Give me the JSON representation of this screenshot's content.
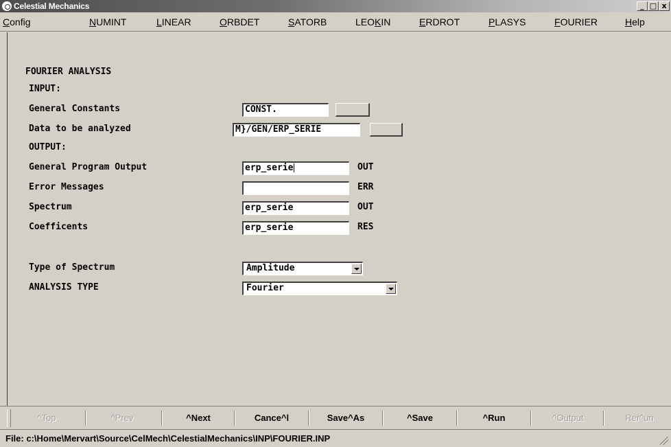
{
  "window": {
    "title": "Celestial Mechanics",
    "controls": {
      "minimize": "_",
      "maximize": "□",
      "close": "x"
    }
  },
  "menu": [
    {
      "label": "Config",
      "mnemonic": "C",
      "rest": "onfig"
    },
    {
      "label": "NUMINT",
      "mnemonic": "N",
      "rest": "UMINT"
    },
    {
      "label": "LINEAR",
      "mnemonic": "L",
      "rest": "INEAR"
    },
    {
      "label": "ORBDET",
      "mnemonic": "O",
      "rest": "RBDET"
    },
    {
      "label": "SATORB",
      "mnemonic": "S",
      "rest": "ATORB"
    },
    {
      "label": "LEOKIN",
      "pre": "LEO",
      "mnemonic": "K",
      "rest": "IN"
    },
    {
      "label": "ERDROT",
      "mnemonic": "E",
      "rest": "RDROT"
    },
    {
      "label": "PLASYS",
      "mnemonic": "P",
      "rest": "LASYS"
    },
    {
      "label": "FOURIER",
      "mnemonic": "F",
      "rest": "OURIER"
    },
    {
      "label": "Help",
      "mnemonic": "H",
      "rest": "elp"
    }
  ],
  "form": {
    "heading": "FOURIER ANALYSIS",
    "input_section": "INPUT:",
    "general_constants": {
      "label": "General Constants",
      "value": "CONST."
    },
    "data_to_analyze": {
      "label": "Data to be analyzed",
      "value": "M}/GEN/ERP_SERIE"
    },
    "output_section": "OUTPUT:",
    "program_output": {
      "label": "General Program Output",
      "value": "erp_serie",
      "ext": "OUT"
    },
    "error_messages": {
      "label": "Error Messages",
      "value": "",
      "ext": "ERR"
    },
    "spectrum": {
      "label": "Spectrum",
      "value": "erp_serie",
      "ext": "OUT"
    },
    "coefficients": {
      "label": "Coefficents",
      "value": "erp_serie",
      "ext": "RES"
    },
    "spectrum_type": {
      "label": "Type of Spectrum",
      "selected": "Amplitude"
    },
    "analysis_type": {
      "label": "ANALYSIS TYPE",
      "selected": "Fourier"
    }
  },
  "toolbar": {
    "top": "^Top",
    "prev": "^Prev",
    "next": "^Next",
    "cancel": "Cance^l",
    "save_as": "Save^As",
    "save": "^Save",
    "run": "^Run",
    "output": "^Output",
    "rerun": "Rer^un"
  },
  "status": {
    "file": "File: c:\\Home\\Mervart\\Source\\CelMech\\CelestialMechanics\\INP\\FOURIER.INP"
  }
}
